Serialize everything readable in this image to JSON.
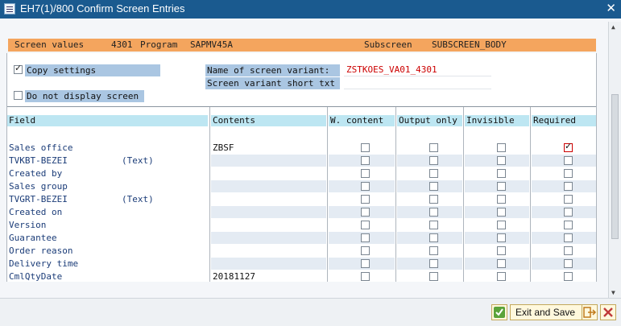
{
  "window": {
    "title": "EH7(1)/800 Confirm Screen Entries",
    "close_glyph": "✕"
  },
  "header_bar": {
    "screen_values_label": "Screen values",
    "screen_number": "4301",
    "program_label": "Program",
    "program_name": "SAPMV45A",
    "subscreen_label": "Subscreen",
    "subscreen_name": "SUBSCREEN_BODY"
  },
  "settings": {
    "copy_settings_label": "Copy settings",
    "copy_settings_checked": true,
    "do_not_display_label": "Do not display screen",
    "do_not_display_checked": false,
    "variant_name_label": "Name of screen variant:",
    "variant_name_value": "ZSTKOES_VA01_4301",
    "variant_short_label": "Screen variant short txt",
    "variant_short_value": ""
  },
  "table": {
    "headers": [
      "Field",
      "Contents",
      "W. content",
      "Output only",
      "Invisible",
      "Required"
    ],
    "rows": [
      {
        "field": "Sales office",
        "text": "",
        "contents": "ZBSF",
        "required": true
      },
      {
        "field": "TVKBT-BEZEI",
        "text": "(Text)",
        "contents": "",
        "required": false
      },
      {
        "field": "Created by",
        "text": "",
        "contents": "",
        "required": false
      },
      {
        "field": "Sales group",
        "text": "",
        "contents": "",
        "required": false
      },
      {
        "field": "TVGRT-BEZEI",
        "text": "(Text)",
        "contents": "",
        "required": false
      },
      {
        "field": "Created on",
        "text": "",
        "contents": "",
        "required": false
      },
      {
        "field": "Version",
        "text": "",
        "contents": "",
        "required": false
      },
      {
        "field": "Guarantee",
        "text": "",
        "contents": "",
        "required": false
      },
      {
        "field": "Order reason",
        "text": "",
        "contents": "",
        "required": false
      },
      {
        "field": "Delivery time",
        "text": "",
        "contents": "",
        "required": false
      },
      {
        "field": "CmlQtyDate",
        "text": "",
        "contents": "20181127",
        "required": false
      }
    ]
  },
  "footer": {
    "confirm_icon": "checkmark-icon",
    "exit_save_label": "Exit and Save",
    "exit_icon": "exit-icon",
    "close_icon": "close-icon"
  },
  "colors": {
    "titlebar": "#1a5a8f",
    "header_bar": "#f4a55e",
    "column_header": "#bde6f2",
    "label_blue": "#aac6e2",
    "variant_value_red": "#cc0000"
  }
}
